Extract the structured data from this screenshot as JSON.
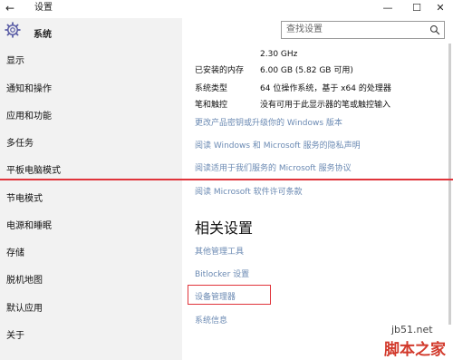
{
  "window": {
    "back_glyph": "←",
    "title": "设置",
    "minimize_glyph": "—",
    "maximize_glyph": "☐",
    "close_glyph": "✕"
  },
  "header": {
    "app_name": "系统",
    "icon": "gear-icon"
  },
  "search": {
    "placeholder": "查找设置",
    "icon": "search-icon"
  },
  "sidebar": {
    "items": [
      {
        "label": "显示"
      },
      {
        "label": "通知和操作"
      },
      {
        "label": "应用和功能"
      },
      {
        "label": "多任务"
      },
      {
        "label": "平板电脑模式"
      },
      {
        "label": "节电模式"
      },
      {
        "label": "电源和睡眠"
      },
      {
        "label": "存储"
      },
      {
        "label": "脱机地图"
      },
      {
        "label": "默认应用"
      },
      {
        "label": "关于"
      }
    ]
  },
  "system_info": {
    "cpu_speed": "2.30 GHz",
    "rows": [
      {
        "label": "已安装的内存",
        "value": "6.00 GB (5.82 GB 可用)"
      },
      {
        "label": "系统类型",
        "value": "64 位操作系统，基于 x64 的处理器"
      },
      {
        "label": "笔和触控",
        "value": "没有可用于此显示器的笔或触控输入"
      }
    ]
  },
  "links": [
    {
      "label": "更改产品密钥或升级你的 Windows 版本"
    },
    {
      "label": "阅读 Windows 和 Microsoft 服务的隐私声明"
    },
    {
      "label": "阅读适用于我们服务的 Microsoft 服务协议"
    },
    {
      "label": "阅读 Microsoft 软件许可条款"
    }
  ],
  "related": {
    "heading": "相关设置",
    "links": [
      {
        "label": "其他管理工具"
      },
      {
        "label": "Bitlocker 设置"
      },
      {
        "label": "设备管理器"
      },
      {
        "label": "系统信息"
      }
    ]
  },
  "annotation_color": "#e0343b",
  "link_color": "#6b8ab3",
  "watermark": {
    "site": "jb51.net",
    "brand": "脚本之家"
  }
}
